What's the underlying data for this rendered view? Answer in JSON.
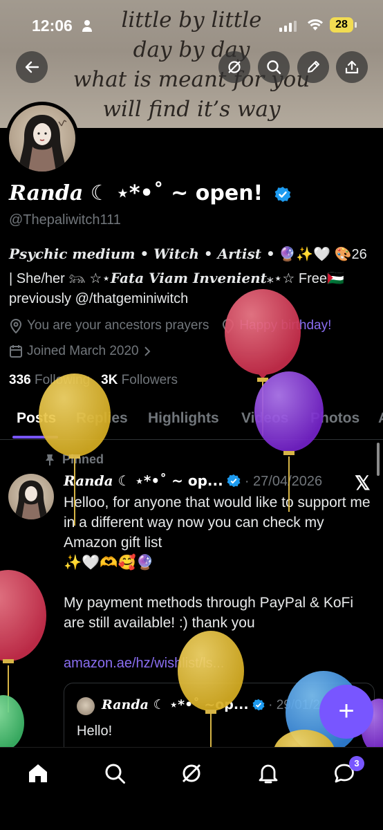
{
  "status_bar": {
    "time": "12:06",
    "battery": "28"
  },
  "banner": {
    "lines": [
      "little by little",
      "day by day",
      "what is meant for you",
      "will find it’s way"
    ]
  },
  "header_buttons": [
    "back-arrow-icon",
    "grok-icon",
    "search-icon",
    "edit-icon",
    "share-icon"
  ],
  "profile": {
    "name": "Randa",
    "name_suffix": "☾ ⋆*•˚ ~ open!",
    "handle": "@Thepaliwitch111",
    "bio_serif": "Psychic medium • Witch • Artist •",
    "bio_emojis": "🔮✨🤍 🎨26",
    "bio_line2_prefix": "| She/her 𓃬 ☆⋆",
    "bio_line2_serif": "Fata Viam Invenient",
    "bio_line2_suffix": "⁎⋆☆ Free🇵🇸",
    "bio_line3": "previously @/thatgeminiwitch",
    "location": "You are your ancestors prayers",
    "birthday": "Happy birthday!",
    "joined": "Joined March 2020",
    "following_count": "336",
    "following_label": "Following",
    "followers_count": "3K",
    "followers_label": "Followers"
  },
  "tabs": [
    "Posts",
    "Replies",
    "Highlights",
    "Videos",
    "Photos",
    "A"
  ],
  "active_tab": "Posts",
  "post": {
    "pinned_label": "Pinned",
    "author": "Randa",
    "author_suffix": "☾ ⋆*•˚ ~ op...",
    "date": "· 27/04/2026",
    "body_line1": "Helloo, for anyone that would like to support me in a different way now you can check my Amazon gift list",
    "body_emojis": "✨🤍🫶🥰🔮",
    "body_line2": "My payment methods through PayPal & KoFi are still available! :) thank you",
    "link": "amazon.ae/hz/wishlist/ls...",
    "quote": {
      "author": "Randa",
      "author_suffix": "☾ ⋆*•˚ ~op...",
      "date": "· 29/01/2",
      "text": "Hello!"
    }
  },
  "fab_label": "+",
  "bottom_nav": [
    "home-icon",
    "search-icon",
    "grok-icon",
    "notifications-icon",
    "messages-icon"
  ],
  "messages_badge": "3",
  "colors": {
    "accent": "#7856ff",
    "verified": "#1d9bf0",
    "muted": "#71767b"
  }
}
